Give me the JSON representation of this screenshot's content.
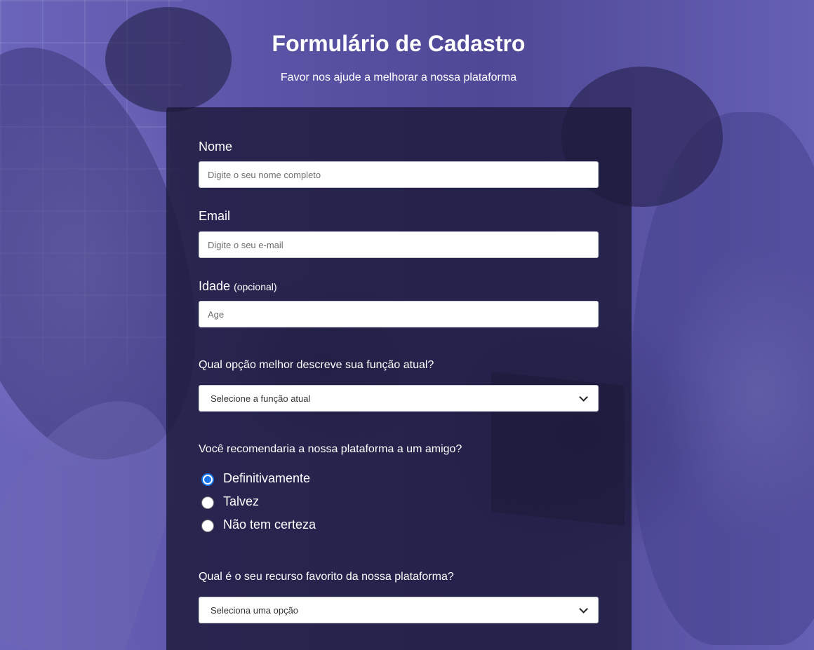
{
  "header": {
    "title": "Formulário de Cadastro",
    "subtitle": "Favor nos ajude a melhorar a nossa plataforma"
  },
  "form": {
    "name": {
      "label": "Nome",
      "placeholder": "Digite o seu nome completo"
    },
    "email": {
      "label": "Email",
      "placeholder": "Digite o seu e-mail"
    },
    "age": {
      "label": "Idade",
      "optional": "(opcional)",
      "placeholder": "Age"
    },
    "role": {
      "question": "Qual opção melhor descreve sua função atual?",
      "selected": "Selecione a função atual"
    },
    "recommend": {
      "question": "Você recomendaria a nossa plataforma a um amigo?",
      "options": [
        "Definitivamente",
        "Talvez",
        "Não tem certeza"
      ],
      "selected_index": 0
    },
    "feature": {
      "question": "Qual é o seu recurso favorito da nossa plataforma?",
      "selected": "Seleciona uma opção"
    }
  },
  "colors": {
    "accent": "#1a73e8",
    "card": "#1c1a3a",
    "background": "#5b54a6"
  }
}
